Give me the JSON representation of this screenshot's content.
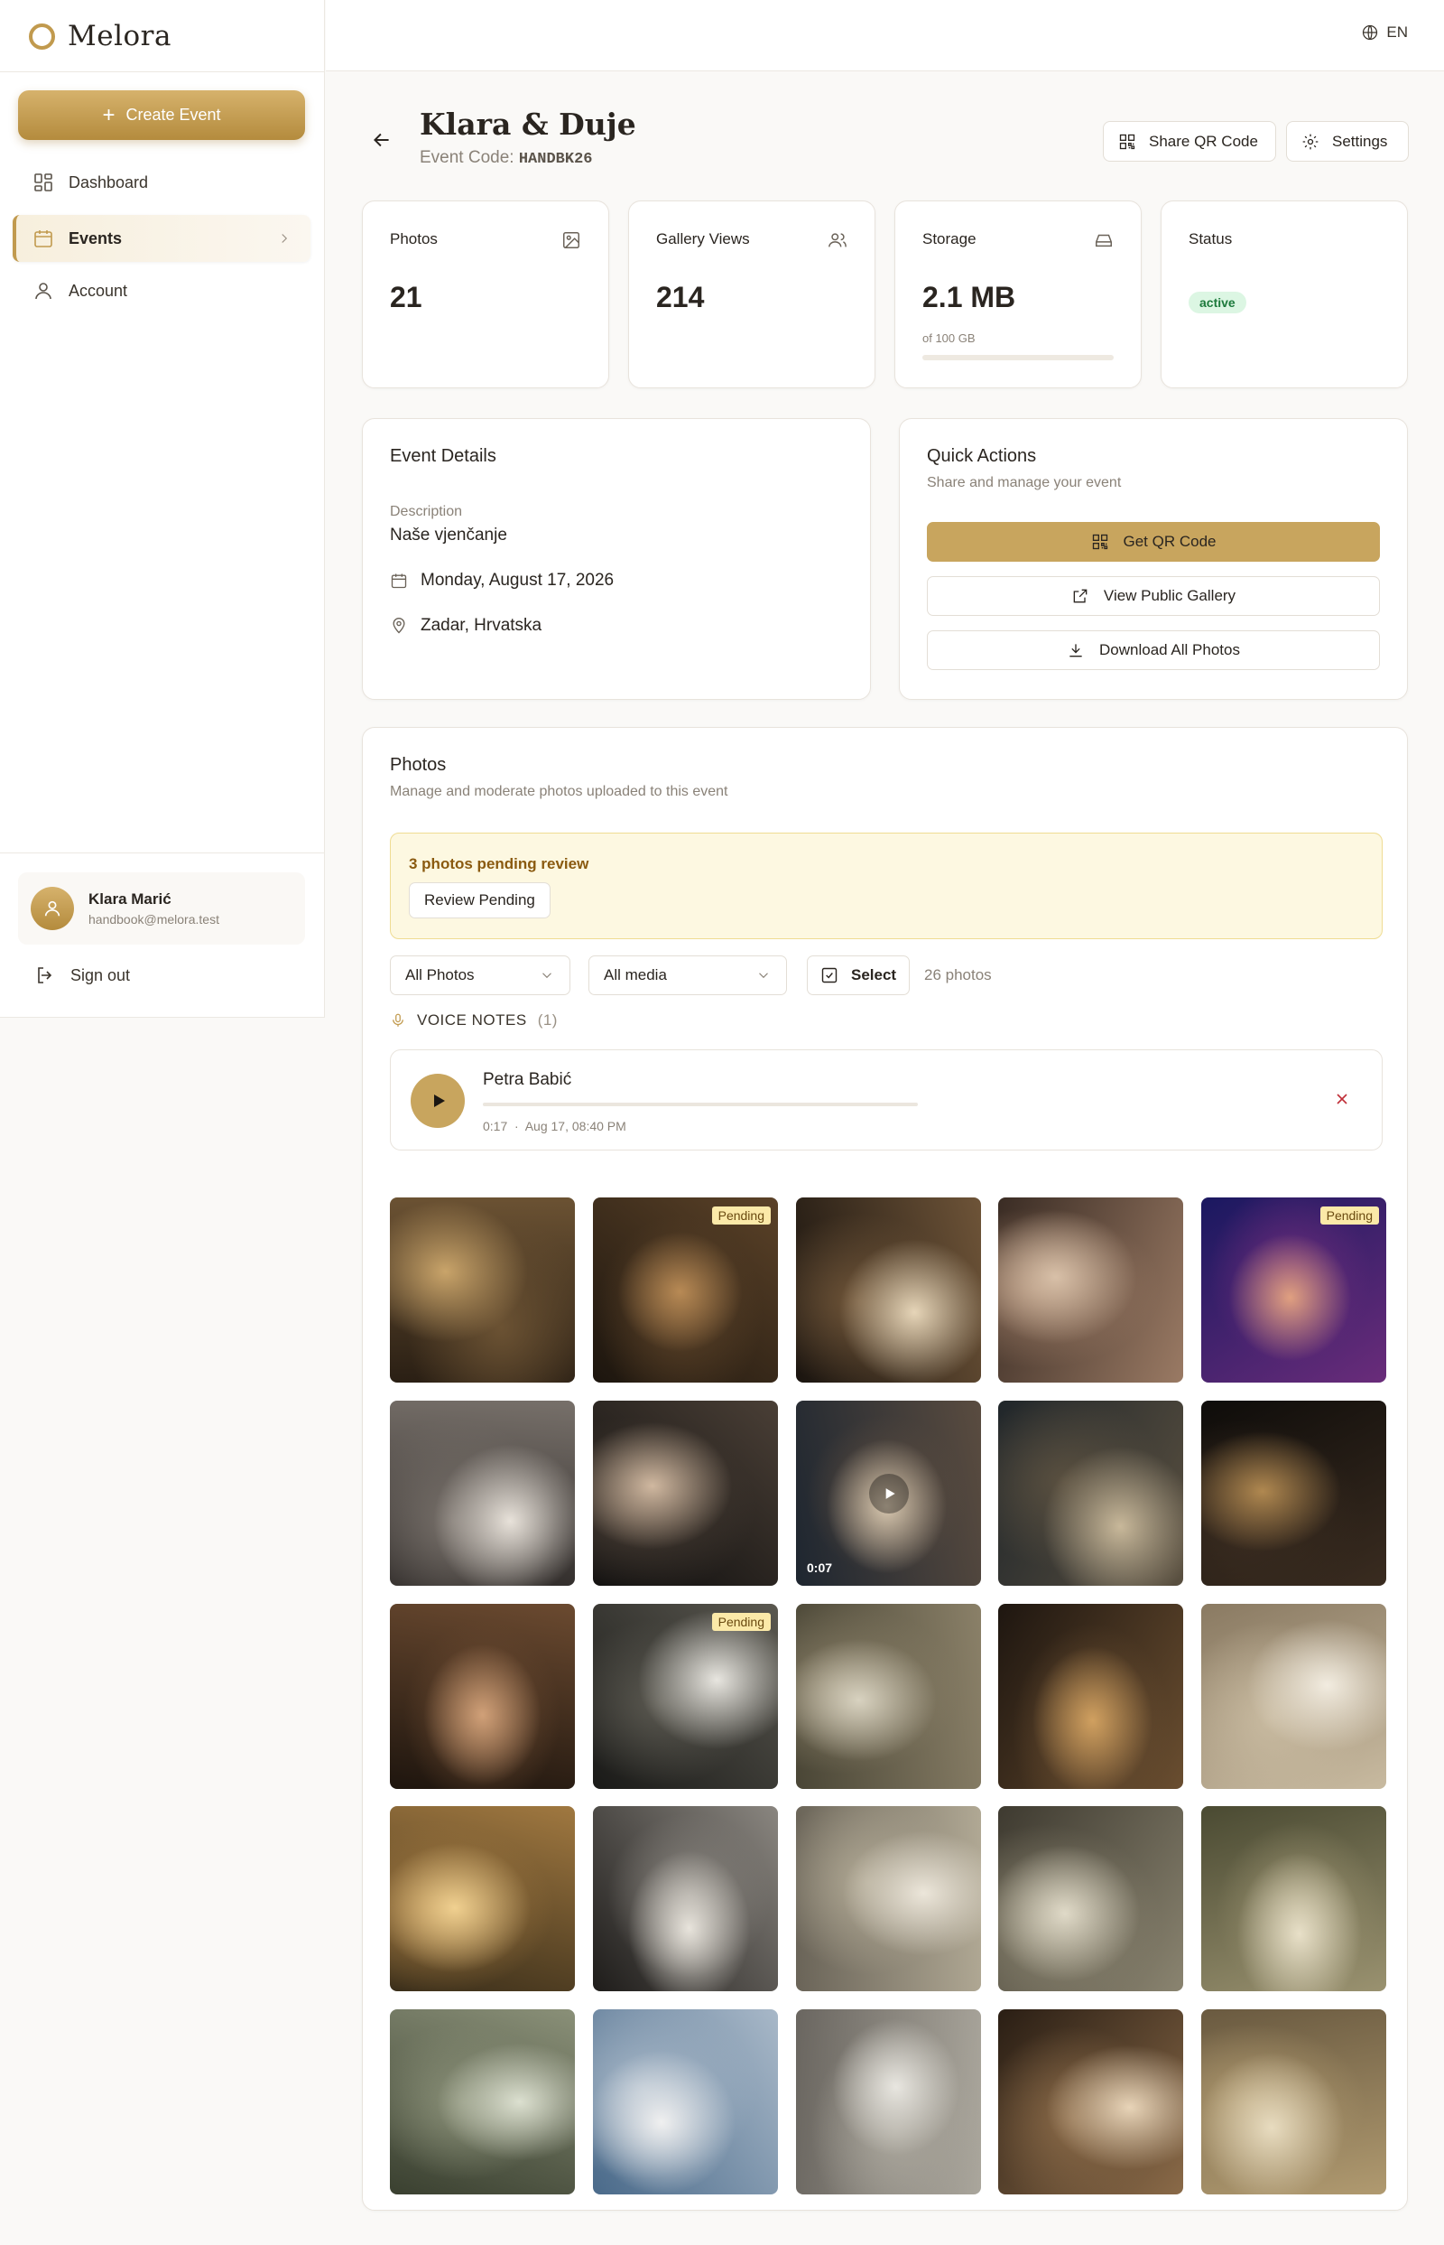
{
  "sidebar": {
    "brand": "Melora",
    "create_label": "Create Event",
    "nav": [
      {
        "label": "Dashboard",
        "icon": "grid-icon"
      },
      {
        "label": "Events",
        "icon": "calendar-icon",
        "active": true
      },
      {
        "label": "Account",
        "icon": "user-icon"
      }
    ],
    "user": {
      "name": "Klara Marić",
      "email": "handbook@melora.test"
    },
    "signout_label": "Sign out"
  },
  "header": {
    "lang": "EN"
  },
  "event": {
    "title": "Klara & Duje",
    "code_label": "Event Code:",
    "code": "HANDBK26",
    "share_label": "Share QR Code",
    "settings_label": "Settings"
  },
  "stats": {
    "photos": {
      "label": "Photos",
      "value": "21"
    },
    "views": {
      "label": "Gallery Views",
      "value": "214"
    },
    "storage": {
      "label": "Storage",
      "value": "2.1 MB",
      "sub": "of 100 GB",
      "used_fraction": 2e-05
    },
    "status": {
      "label": "Status",
      "value": "active"
    }
  },
  "details": {
    "title": "Event Details",
    "desc_label": "Description",
    "description": "Naše vjenčanje",
    "date": "Monday, August 17, 2026",
    "location": "Zadar, Hrvatska"
  },
  "quick_actions": {
    "title": "Quick Actions",
    "subtitle": "Share and manage your event",
    "qr_label": "Get QR Code",
    "gallery_label": "View Public Gallery",
    "download_label": "Download All Photos"
  },
  "photos": {
    "title": "Photos",
    "subtitle": "Manage and moderate photos uploaded to this event",
    "pending_text": "3 photos pending review",
    "review_label": "Review Pending",
    "filter_all": "All Photos",
    "filter_media": "All media",
    "select_label": "Select",
    "count": "26 photos",
    "voice_notes_label": "VOICE NOTES",
    "voice_notes_count": "(1)",
    "voice_note": {
      "name": "Petra Babić",
      "duration": "0:17",
      "sep": "·",
      "time": "Aug 17, 08:40 PM"
    },
    "pending_tag": "Pending",
    "video_duration": "0:07",
    "grid": [
      {
        "scene": "candle-table"
      },
      {
        "scene": "dinner-crowd",
        "pending": true
      },
      {
        "scene": "sparkler-couple"
      },
      {
        "scene": "selfie-group"
      },
      {
        "scene": "band-stage",
        "pending": true
      },
      {
        "scene": "dancing-men"
      },
      {
        "scene": "dance-floor-night"
      },
      {
        "scene": "couple-kiss-video",
        "video": true
      },
      {
        "scene": "couple-evening"
      },
      {
        "scene": "lights-dance"
      },
      {
        "scene": "laughing-women"
      },
      {
        "scene": "running-kid",
        "pending": true
      },
      {
        "scene": "toast-table"
      },
      {
        "scene": "speech-hall"
      },
      {
        "scene": "qr-sign"
      },
      {
        "scene": "sunset-table"
      },
      {
        "scene": "guests-silhouette"
      },
      {
        "scene": "bride-walk-stone"
      },
      {
        "scene": "confetti-couple"
      },
      {
        "scene": "embrace-olive"
      },
      {
        "scene": "guests-trees"
      },
      {
        "scene": "groomsmen"
      },
      {
        "scene": "bride-prep"
      },
      {
        "scene": "dress-window"
      },
      {
        "scene": "rings-cloth"
      }
    ]
  }
}
